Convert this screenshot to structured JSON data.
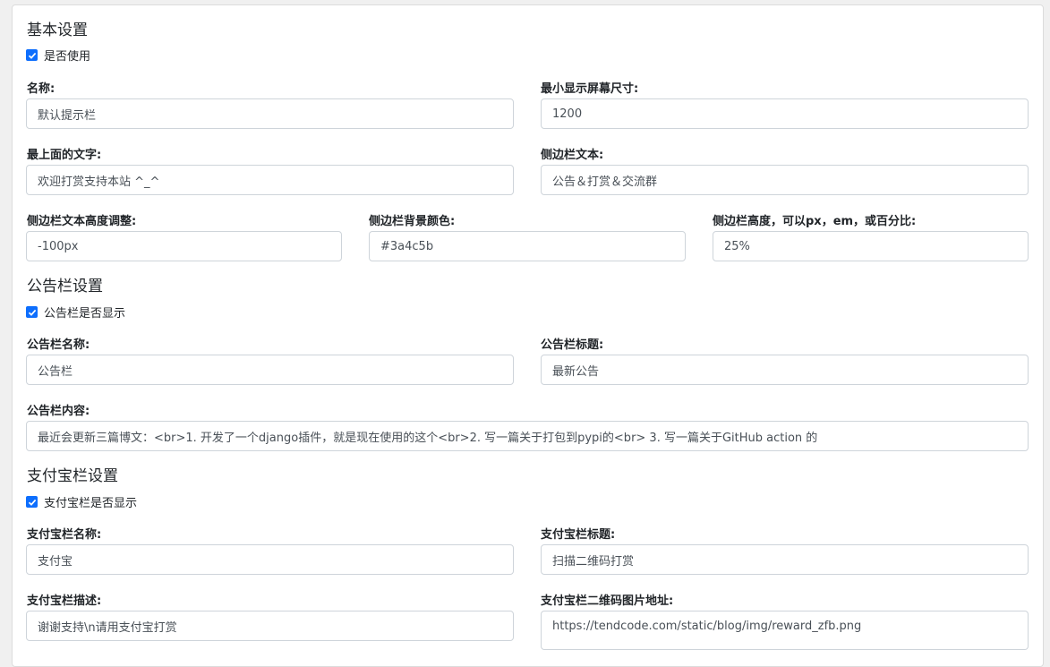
{
  "basic": {
    "title": "基本设置",
    "enable_label": "是否使用",
    "name_label": "名称:",
    "name_value": "默认提示栏",
    "min_width_label": "最小显示屏幕尺寸:",
    "min_width_value": "1200",
    "top_text_label": "最上面的文字:",
    "top_text_value": "欢迎打赏支持本站 ^_^",
    "side_text_label": "侧边栏文本:",
    "side_text_value": "公告＆打赏＆交流群",
    "side_height_adj_label": "侧边栏文本高度调整:",
    "side_height_adj_value": "-100px",
    "side_bg_label": "侧边栏背景颜色:",
    "side_bg_value": "#3a4c5b",
    "side_height_label": "侧边栏高度，可以px，em，或百分比:",
    "side_height_value": "25%"
  },
  "notice": {
    "title": "公告栏设置",
    "show_label": "公告栏是否显示",
    "name_label": "公告栏名称:",
    "name_value": "公告栏",
    "heading_label": "公告栏标题:",
    "heading_value": "最新公告",
    "content_label": "公告栏内容:",
    "content_value": "最近会更新三篇博文：<br>1. 开发了一个django插件，就是现在使用的这个<br>2. 写一篇关于打包到pypi的<br> 3. 写一篇关于GitHub action 的"
  },
  "alipay": {
    "title": "支付宝栏设置",
    "show_label": "支付宝栏是否显示",
    "name_label": "支付宝栏名称:",
    "name_value": "支付宝",
    "heading_label": "支付宝栏标题:",
    "heading_value": "扫描二维码打赏",
    "desc_label": "支付宝栏描述:",
    "desc_value": "谢谢支持\\n请用支付宝打赏",
    "qr_label": "支付宝栏二维码图片地址:",
    "qr_value": "https://tendcode.com/static/blog/img/reward_zfb.png"
  },
  "colors": {
    "accent": "#0d6efd",
    "border": "#ced4da"
  }
}
